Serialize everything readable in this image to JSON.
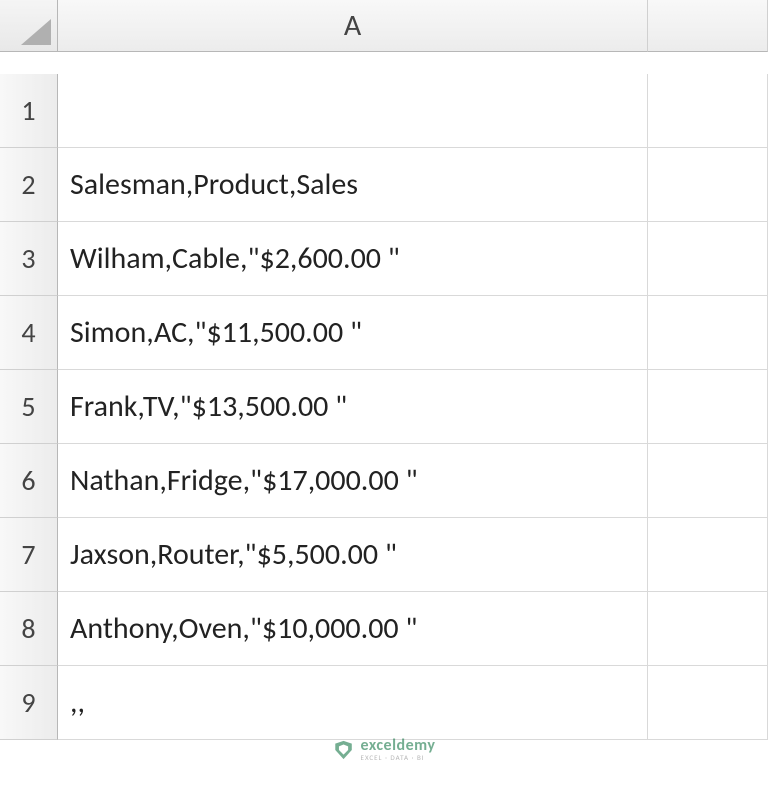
{
  "columns": [
    "A"
  ],
  "row_count": 9,
  "cells": {
    "A1": "",
    "A2": "Salesman,Product,Sales",
    "A3": "Wilham,Cable,\"$2,600.00 \"",
    "A4": "Simon,AC,\"$11,500.00 \"",
    "A5": "Frank,TV,\"$13,500.00 \"",
    "A6": "Nathan,Fridge,\"$17,000.00 \"",
    "A7": "Jaxson,Router,\"$5,500.00 \"",
    "A8": "Anthony,Oven,\"$10,000.00 \"",
    "A9": ",,"
  },
  "row_labels": [
    "1",
    "2",
    "3",
    "4",
    "5",
    "6",
    "7",
    "8",
    "9"
  ],
  "watermark": {
    "main": "exceldemy",
    "sub": "EXCEL · DATA · BI"
  }
}
